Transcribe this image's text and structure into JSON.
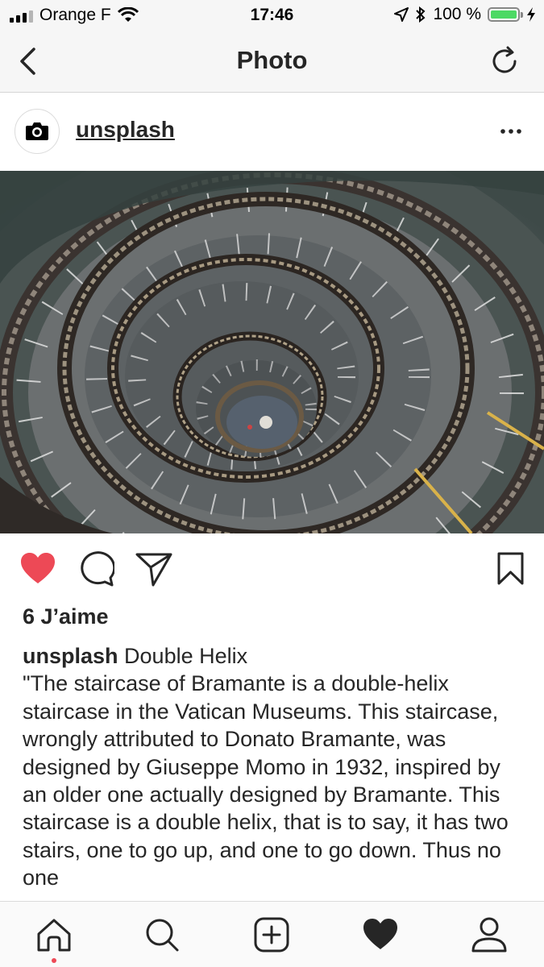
{
  "status_bar": {
    "carrier": "Orange F",
    "time": "17:46",
    "battery": "100 %",
    "battery_level": 1.0
  },
  "nav": {
    "title": "Photo",
    "back_icon": "chevron-left-icon",
    "refresh_icon": "refresh-icon"
  },
  "post": {
    "username": "unsplash",
    "avatar_icon": "camera-icon",
    "more_icon": "more-dots-icon",
    "photo_alt": "Double helix staircase",
    "liked": true,
    "likes_text": "6 J’aime",
    "caption_user": "unsplash",
    "caption_text": " Double Helix\n\"The staircase of Bramante is a double-helix staircase in the Vatican Museums. This staircase, wrongly attributed to Donato Bramante, was designed by Giuseppe Momo in 1932, inspired by an older one actually designed by Bramante. This staircase is a double helix, that is to say, it has two stairs, one to go up, and one to go down. Thus no one",
    "like_color": "#ed4956"
  },
  "tab_bar": {
    "items": [
      "home-icon",
      "search-icon",
      "add-post-icon",
      "activity-heart-icon",
      "profile-icon"
    ],
    "active": "home-icon"
  }
}
